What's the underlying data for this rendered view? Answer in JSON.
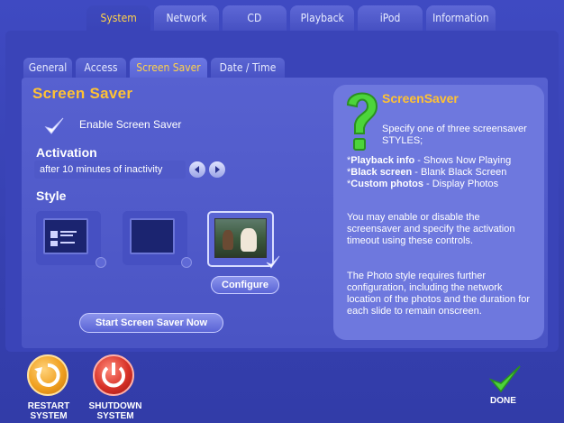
{
  "top_tabs": [
    {
      "label": "System",
      "active": true
    },
    {
      "label": "Network",
      "active": false
    },
    {
      "label": "CD",
      "active": false
    },
    {
      "label": "Playback",
      "active": false
    },
    {
      "label": "iPod",
      "active": false
    },
    {
      "label": "Information",
      "active": false
    }
  ],
  "sub_tabs": [
    {
      "label": "General",
      "active": false
    },
    {
      "label": "Access",
      "active": false
    },
    {
      "label": "Screen Saver",
      "active": true
    },
    {
      "label": "Date / Time",
      "active": false
    }
  ],
  "screen_saver": {
    "title": "Screen Saver",
    "enable_label": "Enable Screen Saver",
    "enabled": true,
    "activation_heading": "Activation",
    "activation_value": "after 10 minutes of inactivity",
    "style_heading": "Style",
    "styles": [
      "Playback info",
      "Black screen",
      "Custom photos"
    ],
    "selected_style": "Custom photos",
    "configure_label": "Configure",
    "start_label": "Start Screen Saver Now"
  },
  "help": {
    "title": "ScreenSaver",
    "intro": "Specify one of three screensaver STYLES;",
    "items": [
      {
        "name": "Playback info",
        "desc": "Shows Now Playing"
      },
      {
        "name": "Black screen",
        "desc": "Blank Black Screen"
      },
      {
        "name": "Custom photos",
        "desc": "Display Photos"
      }
    ],
    "paragraph2": "You may enable or disable the screensaver and specify the activation timeout using these controls.",
    "paragraph3": "The Photo style requires further configuration, including the network location of the photos and the duration for each slide to remain onscreen."
  },
  "bottom": {
    "restart_label": "RESTART SYSTEM",
    "shutdown_label": "SHUTDOWN SYSTEM",
    "done_label": "DONE"
  },
  "colors": {
    "background": "#3a44b8",
    "accent": "#ffc233",
    "panel": "#4a54c4",
    "help_box": "#6e78de"
  }
}
